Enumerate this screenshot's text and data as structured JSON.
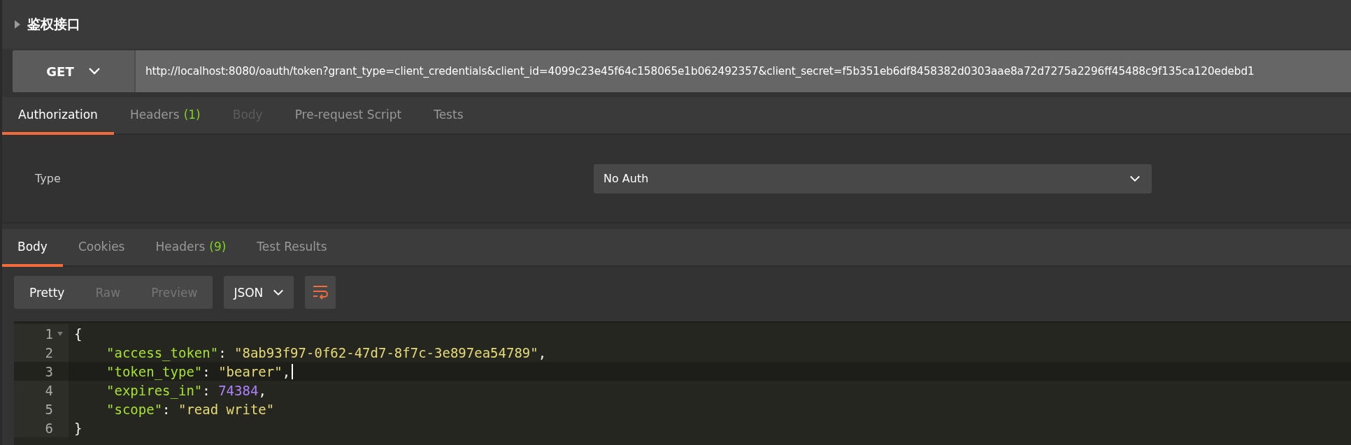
{
  "request": {
    "name": "鉴权接口",
    "expanded": false,
    "method": "GET",
    "url": "http://localhost:8080/oauth/token?grant_type=client_credentials&client_id=4099c23e45f64c158065e1b062492357&client_secret=f5b351eb6df8458382d0303aae8a72d7275a2296ff45488c9f135ca120edebd1"
  },
  "request_tabs": [
    {
      "label": "Authorization",
      "selected": true,
      "disabled": false
    },
    {
      "label": "Headers",
      "count": "(1)",
      "selected": false,
      "disabled": false
    },
    {
      "label": "Body",
      "selected": false,
      "disabled": true
    },
    {
      "label": "Pre-request Script",
      "selected": false,
      "disabled": false
    },
    {
      "label": "Tests",
      "selected": false,
      "disabled": false
    }
  ],
  "auth": {
    "type_label": "Type",
    "type_value": "No Auth"
  },
  "response_tabs": [
    {
      "label": "Body",
      "selected": true
    },
    {
      "label": "Cookies",
      "selected": false
    },
    {
      "label": "Headers",
      "count": "(9)",
      "selected": false
    },
    {
      "label": "Test Results",
      "selected": false
    }
  ],
  "view_modes": [
    {
      "label": "Pretty",
      "selected": true
    },
    {
      "label": "Raw",
      "selected": false
    },
    {
      "label": "Preview",
      "selected": false
    }
  ],
  "format": "JSON",
  "wrap_on": true,
  "code": [
    {
      "number": "1",
      "foldable": true,
      "current": false,
      "indented": false,
      "tokens": [
        {
          "kind": "punct",
          "text": "{"
        }
      ]
    },
    {
      "number": "2",
      "foldable": false,
      "current": false,
      "indented": true,
      "tokens": [
        {
          "kind": "key",
          "text": "\"access_token\""
        },
        {
          "kind": "punct",
          "text": ": "
        },
        {
          "kind": "string",
          "text": "\"8ab93f97-0f62-47d7-8f7c-3e897ea54789\""
        },
        {
          "kind": "punct",
          "text": ","
        }
      ]
    },
    {
      "number": "3",
      "foldable": false,
      "current": true,
      "indented": true,
      "tokens": [
        {
          "kind": "key",
          "text": "\"token_type\""
        },
        {
          "kind": "punct",
          "text": ": "
        },
        {
          "kind": "string",
          "text": "\"bearer\""
        },
        {
          "kind": "punct",
          "text": ","
        }
      ]
    },
    {
      "number": "4",
      "foldable": false,
      "current": false,
      "indented": true,
      "tokens": [
        {
          "kind": "key",
          "text": "\"expires_in\""
        },
        {
          "kind": "punct",
          "text": ": "
        },
        {
          "kind": "number",
          "text": "74384"
        },
        {
          "kind": "punct",
          "text": ","
        }
      ]
    },
    {
      "number": "5",
      "foldable": false,
      "current": false,
      "indented": true,
      "tokens": [
        {
          "kind": "key",
          "text": "\"scope\""
        },
        {
          "kind": "punct",
          "text": ": "
        },
        {
          "kind": "string",
          "text": "\"read write\""
        }
      ]
    },
    {
      "number": "6",
      "foldable": false,
      "current": false,
      "indented": false,
      "tokens": [
        {
          "kind": "punct",
          "text": "}"
        }
      ]
    }
  ]
}
